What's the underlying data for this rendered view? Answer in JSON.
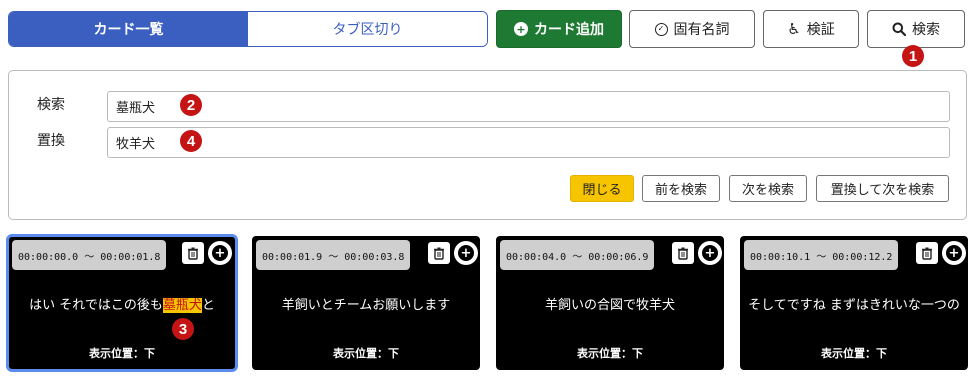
{
  "view_toggle": {
    "cards": "カード一覧",
    "tabs": "タブ区切り"
  },
  "toolbar": {
    "add_card": "カード追加",
    "proper_noun": "固有名詞",
    "verify": "検証",
    "search": "検索"
  },
  "badges": {
    "b1": "1",
    "b2": "2",
    "b3": "3",
    "b4": "4"
  },
  "search_panel": {
    "search_label": "検索",
    "search_value": "墓瓶犬",
    "replace_label": "置換",
    "replace_value": "牧羊犬",
    "close": "閉じる",
    "find_prev": "前を検索",
    "find_next": "次を検索",
    "replace_next": "置換して次を検索"
  },
  "cards": [
    {
      "time": "00:00:00.0 〜 00:00:01.8",
      "text_before": "はい それではこの後も",
      "text_match": "墓瓶犬",
      "text_after": "と",
      "position": "表示位置：下"
    },
    {
      "time": "00:00:01.9 〜 00:00:03.8",
      "text": "羊飼いとチームお願いします",
      "position": "表示位置：下"
    },
    {
      "time": "00:00:04.0 〜 00:00:06.9",
      "text": "羊飼いの合図で牧羊犬",
      "position": "表示位置：下"
    },
    {
      "time": "00:00:10.1 〜 00:00:12.2",
      "text": "そしてですね まずはきれいな一つの",
      "position": "表示位置：下"
    }
  ],
  "colors": {
    "accent": "#3b5fc0",
    "add": "#1e7a33",
    "close": "#f7c400",
    "badge": "#c41414"
  }
}
